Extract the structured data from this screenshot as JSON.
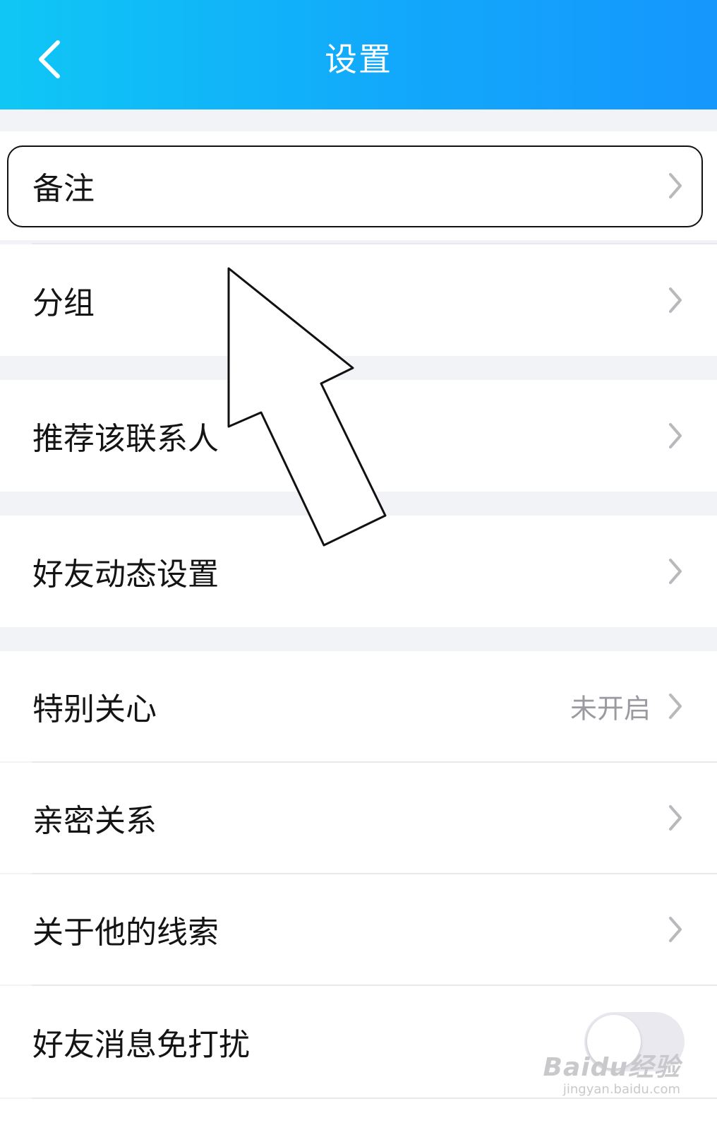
{
  "header": {
    "title": "设置",
    "back_icon": "chevron-left-icon",
    "gradient": [
      "#0fc7f5",
      "#1597fc"
    ]
  },
  "settings": {
    "remark": {
      "label": "备注"
    },
    "group": {
      "label": "分组"
    },
    "recommend": {
      "label": "推荐该联系人"
    },
    "moments": {
      "label": "好友动态设置"
    },
    "special_care": {
      "label": "特别关心",
      "value": "未开启"
    },
    "intimacy": {
      "label": "亲密关系"
    },
    "clues": {
      "label": "关于他的线索"
    },
    "do_not_disturb": {
      "label": "好友消息免打扰",
      "toggle_on": false
    }
  },
  "watermark": {
    "logo": "Baidu经验",
    "url": "jingyan.baidu.com"
  },
  "colors": {
    "background": "#f2f3f7",
    "row": "#ffffff",
    "secondary_text": "#9a9aa0",
    "chevron": "#b8b8bd"
  }
}
